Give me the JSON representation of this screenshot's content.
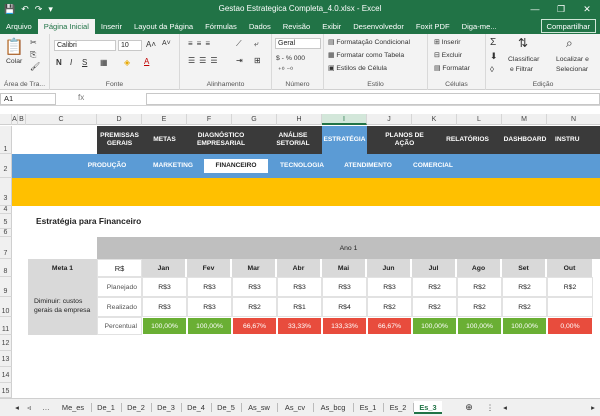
{
  "window": {
    "title": "Gestao Estrategica Completa_4.0.xlsx  -  Excel",
    "controls": [
      "—",
      "❐",
      "✕"
    ]
  },
  "quick_access": [
    "💾",
    "↶",
    "↷",
    "▾"
  ],
  "ribbon_tabs": [
    "Arquivo",
    "Página Inicial",
    "Inserir",
    "Layout da Página",
    "Fórmulas",
    "Dados",
    "Revisão",
    "Exibir",
    "Desenvolvedor",
    "Foxit PDF",
    "Diga-me..."
  ],
  "share_label": "Compartilhar",
  "ribbon": {
    "clipboard": {
      "paste": "Colar",
      "label": "Área de Tra..."
    },
    "font": {
      "name": "Calibri",
      "size": "10",
      "bold": "N",
      "italic": "I",
      "underline": "S",
      "label": "Fonte"
    },
    "alignment": {
      "label": "Alinhamento"
    },
    "number": {
      "format": "Geral",
      "currency": "$ - %  000",
      "label": "Número"
    },
    "styles": {
      "cond": "Formatação Condicional",
      "table": "Formatar como Tabela",
      "cell": "Estilos de Célula",
      "label": "Estilo"
    },
    "cells": {
      "insert": "Inserir",
      "delete": "Excluir",
      "format": "Formatar",
      "label": "Células"
    },
    "editing": {
      "sort1": "Classificar",
      "sort2": "e Filtrar",
      "find1": "Localizar e",
      "find2": "Selecionar",
      "label": "Edição"
    }
  },
  "formula_bar": {
    "name_box": "A1",
    "fx": "fx",
    "value": ""
  },
  "columns": [
    "A",
    "B",
    "C",
    "D",
    "E",
    "F",
    "G",
    "H",
    "I",
    "J",
    "K",
    "L",
    "M",
    "N"
  ],
  "rows": [
    "1",
    "2",
    "3",
    "4",
    "5",
    "6",
    "7",
    "8",
    "9",
    "10",
    "11",
    "12",
    "13",
    "14",
    "15"
  ],
  "nav_primary": [
    "PREMISSAS GERAIS",
    "METAS",
    "DIAGNÓSTICO EMPRESARIAL",
    "ANÁLISE SETORIAL",
    "ESTRATÉGIA",
    "PLANOS DE AÇÃO",
    "RELATÓRIOS",
    "DASHBOARD",
    "INSTRU"
  ],
  "nav_secondary": [
    "PRODUÇÃO",
    "MARKETING",
    "FINANCEIRO",
    "TECNOLOGIA",
    "ATENDIMENTO",
    "COMERCIAL"
  ],
  "section_title": "Estratégia para Financeiro",
  "year_label": "Ano 1",
  "table": {
    "meta": "Meta 1",
    "unit": "R$",
    "months": [
      "Jan",
      "Fev",
      "Mar",
      "Abr",
      "Mai",
      "Jun",
      "Jul",
      "Ago",
      "Set",
      "Out"
    ],
    "goal": "Diminuir: custos gerais da empresa",
    "planned_label": "Planejado",
    "done_label": "Realizado",
    "pct_label": "Percentual",
    "planned": [
      "R$3",
      "R$3",
      "R$3",
      "R$3",
      "R$3",
      "R$3",
      "R$2",
      "R$2",
      "R$2",
      "R$2"
    ],
    "done": [
      "R$3",
      "R$3",
      "R$2",
      "R$1",
      "R$4",
      "R$2",
      "R$2",
      "R$2",
      "R$2",
      ""
    ],
    "percent": [
      "100,00%",
      "100,00%",
      "66,67%",
      "33,33%",
      "133,33%",
      "66,67%",
      "100,00%",
      "100,00%",
      "100,00%",
      "0,00%"
    ],
    "status": [
      "good",
      "good",
      "bad",
      "bad",
      "bad",
      "bad",
      "good",
      "good",
      "good",
      "bad"
    ],
    "colors": {
      "good": "#6aaf34",
      "bad": "#e84c3d"
    }
  },
  "sheet_tabs": [
    "Me_es",
    "De_1",
    "De_2",
    "De_3",
    "De_4",
    "De_5",
    "As_sw",
    "As_cv",
    "As_bcg",
    "Es_1",
    "Es_2",
    "Es_3"
  ],
  "active_sheet": "Es_3"
}
